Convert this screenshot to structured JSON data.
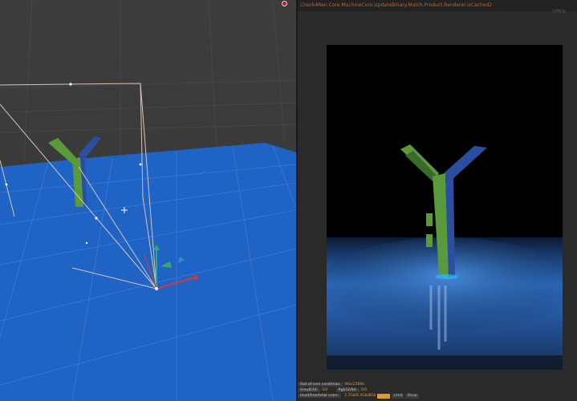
{
  "render_panel": {
    "header_text": "Check4Ren.Core.MachineCore.UpdateBinary.Match.Product.Renderer.isCached2",
    "corner_label": "OPEN",
    "stats": {
      "row1_label": "Out-of-core used/max:",
      "row1_value": "0Kb/256Kb",
      "row2_label": "Grey8/16:",
      "row2_value": "0/0",
      "row2b_label": "Rgb32/64:",
      "row2b_value": "0/0",
      "row3_label": "Used/free/total vram:",
      "row3_value": "2.7Gb/6.4Gb/8Gb",
      "buttons": [
        "",
        "Limit",
        "Show"
      ]
    }
  },
  "colors": {
    "floor_blue": "#1f63c4",
    "viewport_bg": "#3a3a3a",
    "y_green": "#5a9a3a",
    "y_blue": "#2a4fa0",
    "accent_orange": "#e3983c"
  },
  "icons": {
    "close": "close-icon",
    "camera": "camera-icon",
    "light": "light-icon",
    "gizmo": "transform-gizmo-icon"
  }
}
